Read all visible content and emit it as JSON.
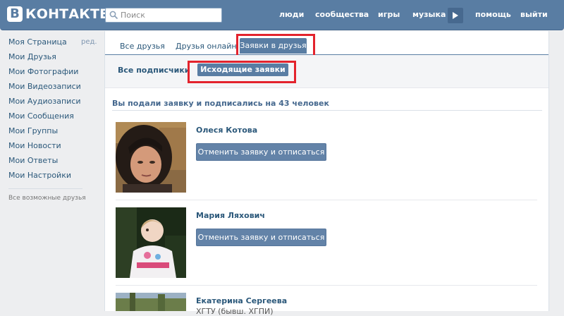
{
  "header": {
    "logo_letter": "В",
    "logo_text": "КОНТАКТЕ",
    "search_placeholder": "Поиск",
    "nav": [
      "люди",
      "сообщества",
      "игры",
      "музыка",
      "помощь",
      "выйти"
    ]
  },
  "sidebar": {
    "items": [
      {
        "label": "Моя Страница",
        "edit": "ред."
      },
      {
        "label": "Мои Друзья"
      },
      {
        "label": "Мои Фотографии"
      },
      {
        "label": "Мои Видеозаписи"
      },
      {
        "label": "Мои Аудиозаписи"
      },
      {
        "label": "Мои Сообщения"
      },
      {
        "label": "Мои Группы"
      },
      {
        "label": "Мои Новости"
      },
      {
        "label": "Мои Ответы"
      },
      {
        "label": "Мои Настройки"
      }
    ],
    "possible_friends": "Все возможные друзья"
  },
  "tabs": {
    "all": "Все друзья",
    "online": "Друзья онлайн",
    "requests": "Заявки в друзья"
  },
  "subtabs": {
    "followers": "Все подписчики",
    "outgoing": "Исходящие заявки"
  },
  "summary": "Вы подали заявку и подписались на 43 человек",
  "friends": [
    {
      "name": "Олеся Котова",
      "button": "Отменить заявку и отписаться"
    },
    {
      "name": "Мария Ляхович",
      "button": "Отменить заявку и отписаться"
    },
    {
      "name": "Екатерина Сергеева",
      "subtitle": "ХГТУ (бывш. ХГПИ)"
    }
  ],
  "colors": {
    "header": "#597da3",
    "accent": "#597da3",
    "link": "#2b587a",
    "highlight": "#e3232d",
    "button": "#6383a8"
  }
}
